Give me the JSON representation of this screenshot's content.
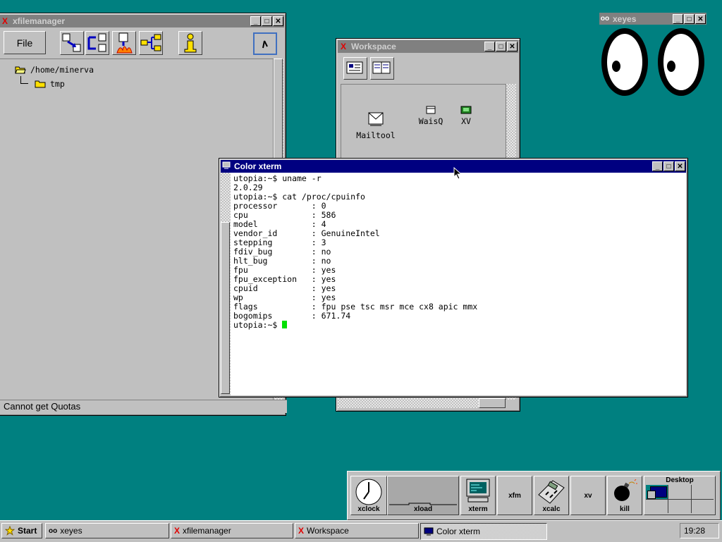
{
  "colors": {
    "desktop": "#008080",
    "active_title": "#000080",
    "inactive_title": "#808080",
    "cursor_block": "#00e000"
  },
  "xfilemanager": {
    "title": "xfilemanager",
    "menu_file": "File",
    "tree": [
      "/home/minerva",
      "tmp"
    ],
    "status": "Cannot get Quotas",
    "toolbar_icons": [
      "copy-icon",
      "move-icon",
      "burn-delete-icon",
      "link-icon",
      "info-icon",
      "pointer-icon"
    ]
  },
  "workspace": {
    "title": "Workspace",
    "items": [
      "Mailtool",
      "WaisQ",
      "XV"
    ]
  },
  "xeyes": {
    "title": "xeyes"
  },
  "xterm": {
    "title": "Color xterm",
    "lines": [
      "utopia:~$ uname -r",
      "2.0.29",
      "utopia:~$ cat /proc/cpuinfo",
      "processor       : 0",
      "cpu             : 586",
      "model           : 4",
      "vendor_id       : GenuineIntel",
      "stepping        : 3",
      "fdiv_bug        : no",
      "hlt_bug         : no",
      "fpu             : yes",
      "fpu_exception   : yes",
      "cpuid           : yes",
      "wp              : yes",
      "flags           : fpu pse tsc msr mce cx8 apic mmx",
      "bogomips        : 671.74"
    ],
    "prompt": "utopia:~$ "
  },
  "dock": {
    "items": [
      "xclock",
      "xload",
      "xterm",
      "xfm",
      "xcalc",
      "xv",
      "kill"
    ],
    "desktop_label": "Desktop"
  },
  "taskbar": {
    "start": "Start",
    "tasks": [
      "xeyes",
      "xfilemanager",
      "Workspace",
      "Color xterm"
    ],
    "clock": "19:28"
  }
}
